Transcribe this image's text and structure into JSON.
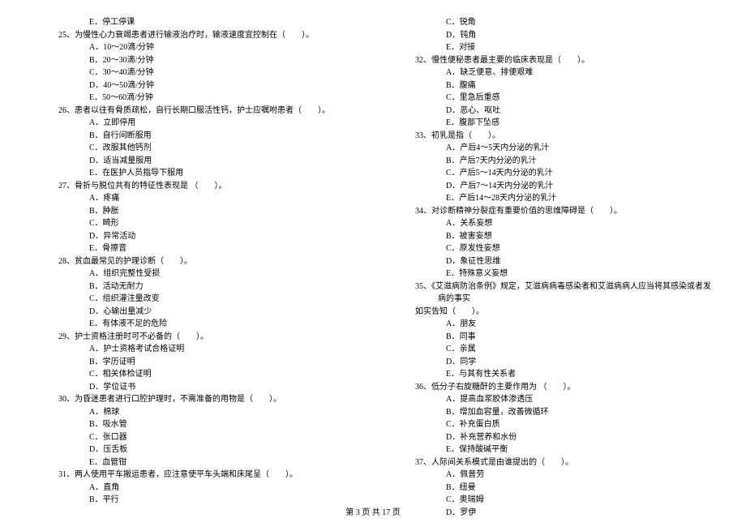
{
  "left": {
    "opt_24e": "E．停工停课",
    "q25": "25、为慢性心力衰竭患者进行输液治疗时，输液速度宜控制在（　　）。",
    "q25a": "A．10～20滴/分钟",
    "q25b": "B．20～30滴/分钟",
    "q25c": "C．30～40滴/分钟",
    "q25d": "D．40～50滴/分钟",
    "q25e": "E．50～60滴/分钟",
    "q26": "26、患者以往有骨质疏松，自行长期口服活性钙，护士应嘱咐患者（　　）。",
    "q26a": "A．立即停用",
    "q26b": "B．自行间断服用",
    "q26c": "C．改服其他钙剂",
    "q26d": "D．适当减量服用",
    "q26e": "E．在医护人员指导下服用",
    "q27": "27、骨折与脱位共有的特征性表现是 （　　）。",
    "q27a": "A．疼痛",
    "q27b": "B．肿胀",
    "q27c": "C．畸形",
    "q27d": "D．异常活动",
    "q27e": "E．骨擦音",
    "q28": "28、贫血最常见的护理诊断（　　）。",
    "q28a": "A．组织完整性受损",
    "q28b": "B．活动无耐力",
    "q28c": "C．组织灌注量改变",
    "q28d": "D．心输出量减少",
    "q28e": "E．有体液不足的危险",
    "q29": "29、护士资格注册时可不必备的（　　）。",
    "q29a": "A．护士资格考试合格证明",
    "q29b": "B．学历证明",
    "q29c": "C．相关体检证明",
    "q29d": "D．学位证书",
    "q30": "30、为昏迷患者进行口腔护理时，不需准备的用物是（　　）。",
    "q30a": "A．棉球",
    "q30b": "B．吸水管",
    "q30c": "C．张口器",
    "q30d": "D．压舌板",
    "q30e": "E．血管钳",
    "q31": "31、两人使用平车搬运患者，应注意使平车头端和床尾呈（　　）。",
    "q31a": "A．直角",
    "q31b": "B．平行"
  },
  "right": {
    "q31c": "C．锐角",
    "q31d": "D．钝角",
    "q31e": "E．对接",
    "q32": "32、慢性便秘患者最主要的临床表现是（　　）。",
    "q32a": "A．缺乏便意、排便艰难",
    "q32b": "B．腹痛",
    "q32c": "C．里急后重感",
    "q32d": "D．恶心、呕吐",
    "q32e": "E．腹部下坠感",
    "q33": "33、初乳是指（　　）。",
    "q33a": "A．产后4～5天内分泌的乳汁",
    "q33b": "B．产后7天内分泌的乳汁",
    "q33c": "C．产后5～14天内分泌的乳汁",
    "q33d": "D．产后7～14天内分泌的乳汁",
    "q33e": "E．产后14～28天内分泌的乳汁",
    "q34": "34、对诊断精神分裂症有重要价值的思维障碍是（　　）。",
    "q34a": "A．关系妄想",
    "q34b": "B．被害妄想",
    "q34c": "C．原发性妄想",
    "q34d": "D．象征性思维",
    "q34e": "E．特殊意义妄想",
    "q35": "35、《艾滋病防治条例》规定，艾滋病病毒感染者和艾滋病病人应当将其感染或者发病的事实",
    "q35_cont": "如实告知（　　）。",
    "q35a": "A．朋友",
    "q35b": "B．同事",
    "q35c": "C．亲属",
    "q35d": "D．同学",
    "q35e": "E．与其有性关系者",
    "q36": "36、低分子右旋糖酐的主要作用为 （　　）。",
    "q36a": "A．提高血浆胶体渗透压",
    "q36b": "B．增加血容量，改善微循环",
    "q36c": "C．补充蛋白质",
    "q36d": "D．补充营养和水份",
    "q36e": "E．保持酸碱平衡",
    "q37": "37、人际间关系模式是由谁提出的（　　）。",
    "q37a": "A．佩普劳",
    "q37b": "B．纽曼",
    "q37c": "C．奥瑞姆",
    "q37d": "D．罗伊"
  },
  "footer": "第 3 页 共 17 页"
}
